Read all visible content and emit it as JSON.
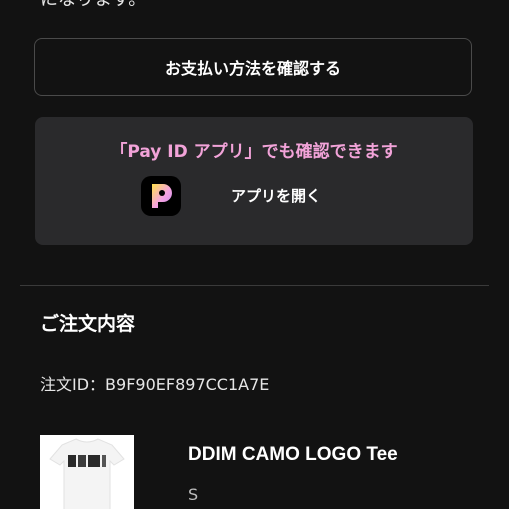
{
  "top_cut_text": "になります。",
  "confirm_payment_button": "お支払い方法を確認する",
  "payid_card": {
    "title": "「Pay ID アプリ」でも確認できます",
    "open_app_label": "アプリを開く",
    "app_icon": "payid-logo-icon",
    "title_color": "#f2a3d9"
  },
  "order": {
    "section_title": "ご注文内容",
    "order_id_label": "注文ID：",
    "order_id_value": "B9F90EF897CC1A7E",
    "product": {
      "name": "DDIM CAMO LOGO Tee",
      "size": "S"
    }
  }
}
